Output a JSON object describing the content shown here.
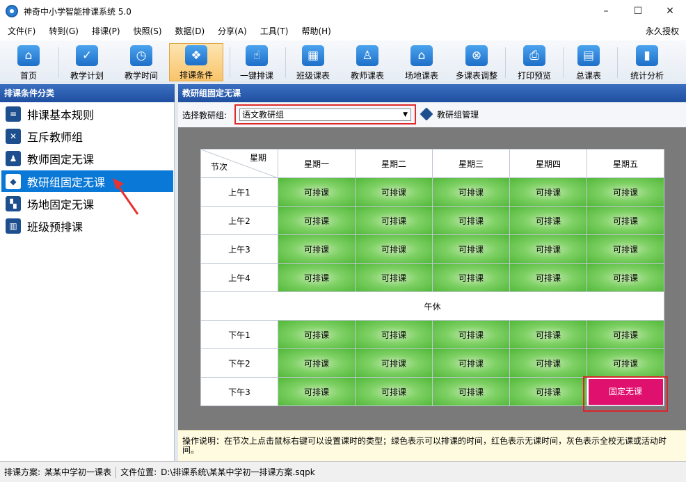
{
  "window": {
    "title": "神奇中小学智能排课系统 5.0",
    "controls": [
      "–",
      "☐",
      "✕"
    ]
  },
  "menu": {
    "items": [
      "文件(F)",
      "转到(G)",
      "排课(P)",
      "快照(S)",
      "数据(D)",
      "分享(A)",
      "工具(T)",
      "帮助(H)"
    ],
    "right": "永久授权"
  },
  "toolbar": {
    "items": [
      {
        "label": "首页",
        "icon": "home-icon",
        "glyph": "⌂"
      },
      {
        "label": "教学计划",
        "icon": "clipboard-check-icon",
        "glyph": "✓"
      },
      {
        "label": "教学时间",
        "icon": "clock-icon",
        "glyph": "◷"
      },
      {
        "label": "排课条件",
        "icon": "cubes-icon",
        "glyph": "❖",
        "active": true
      },
      {
        "label": "一键排课",
        "icon": "hand-pointer-icon",
        "glyph": "☝"
      },
      {
        "label": "班级课表",
        "icon": "calendar-grid-icon",
        "glyph": "▦"
      },
      {
        "label": "教师课表",
        "icon": "teacher-card-icon",
        "glyph": "♙"
      },
      {
        "label": "场地课表",
        "icon": "building-icon",
        "glyph": "⌂"
      },
      {
        "label": "多课表调整",
        "icon": "schedule-adjust-icon",
        "glyph": "⊗"
      },
      {
        "label": "打印预览",
        "icon": "printer-icon",
        "glyph": "⎙"
      },
      {
        "label": "总课表",
        "icon": "calendar-icon",
        "glyph": "▤"
      },
      {
        "label": "统计分析",
        "icon": "bar-chart-icon",
        "glyph": "▮"
      }
    ]
  },
  "left": {
    "header": "排课条件分类",
    "items": [
      {
        "label": "排课基本规则",
        "icon": "rules-icon",
        "glyph": "≡"
      },
      {
        "label": "互斥教师组",
        "icon": "teacher-exclude-icon",
        "glyph": "✕"
      },
      {
        "label": "教师固定无课",
        "icon": "teacher-icon",
        "glyph": "♟"
      },
      {
        "label": "教研组固定无课",
        "icon": "cube-icon",
        "glyph": "◆",
        "active": true
      },
      {
        "label": "场地固定无课",
        "icon": "venue-icon",
        "glyph": "▚"
      },
      {
        "label": "班级预排课",
        "icon": "book-icon",
        "glyph": "▥"
      }
    ]
  },
  "right": {
    "header": "教研组固定无课",
    "filter_label": "选择教研组:",
    "selected_group": "语文教研组",
    "manage_label": "教研组管理"
  },
  "schedule": {
    "corner_top": "星期",
    "corner_bottom": "节次",
    "days": [
      "星期一",
      "星期二",
      "星期三",
      "星期四",
      "星期五"
    ],
    "morning_rows": [
      {
        "label": "上午1",
        "cells": [
          "可排课",
          "可排课",
          "可排课",
          "可排课",
          "可排课"
        ]
      },
      {
        "label": "上午2",
        "cells": [
          "可排课",
          "可排课",
          "可排课",
          "可排课",
          "可排课"
        ]
      },
      {
        "label": "上午3",
        "cells": [
          "可排课",
          "可排课",
          "可排课",
          "可排课",
          "可排课"
        ]
      },
      {
        "label": "上午4",
        "cells": [
          "可排课",
          "可排课",
          "可排课",
          "可排课",
          "可排课"
        ]
      }
    ],
    "noon": "午休",
    "afternoon_rows": [
      {
        "label": "下午1",
        "cells": [
          "可排课",
          "可排课",
          "可排课",
          "可排课",
          "可排课"
        ]
      },
      {
        "label": "下午2",
        "cells": [
          "可排课",
          "可排课",
          "可排课",
          "可排课",
          "可排课"
        ]
      },
      {
        "label": "下午3",
        "cells": [
          "可排课",
          "可排课",
          "可排课",
          "可排课",
          "固定无课"
        ]
      }
    ],
    "fixed_label": "固定无课",
    "colors": {
      "available": "#52b83a",
      "fixed": "#e0106e"
    }
  },
  "help": "操作说明：在节次上点击鼠标右键可以设置课时的类型；绿色表示可以排课的时间，红色表示无课时间，灰色表示全校无课或活动时间。",
  "status": {
    "plan_label": "排课方案:",
    "plan_value": "某某中学初一课表",
    "file_label": "文件位置:",
    "file_value": "D:\\排课系统\\某某中学初一排课方案.sqpk"
  }
}
